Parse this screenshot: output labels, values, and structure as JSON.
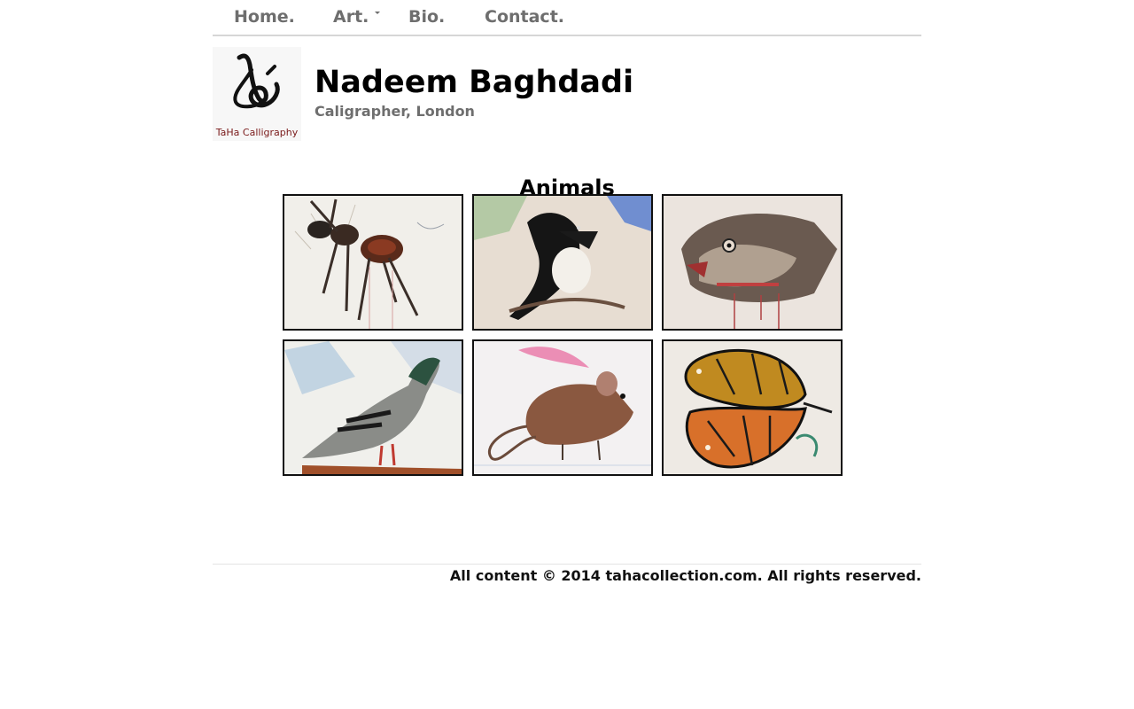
{
  "nav": {
    "items": [
      {
        "label": "Home."
      },
      {
        "label": "Art."
      },
      {
        "label": "Bio."
      },
      {
        "label": "Contact."
      }
    ]
  },
  "logo": {
    "text": "TaHa Calligraphy",
    "icon": "calligraphy-mark"
  },
  "header": {
    "title": "Nadeem Baghdadi",
    "subtitle": "Caligrapher, London"
  },
  "section": {
    "title": "Animals"
  },
  "gallery": {
    "items": [
      {
        "subject": "ant"
      },
      {
        "subject": "magpie"
      },
      {
        "subject": "fish"
      },
      {
        "subject": "pigeon"
      },
      {
        "subject": "rat"
      },
      {
        "subject": "butterfly"
      }
    ]
  },
  "footer": {
    "text": "All content © 2014 tahacollection.com. All rights reserved."
  },
  "colors": {
    "nav_text": "#6e6e6e",
    "title_text": "#000000",
    "logo_red": "#7a1b1b"
  }
}
